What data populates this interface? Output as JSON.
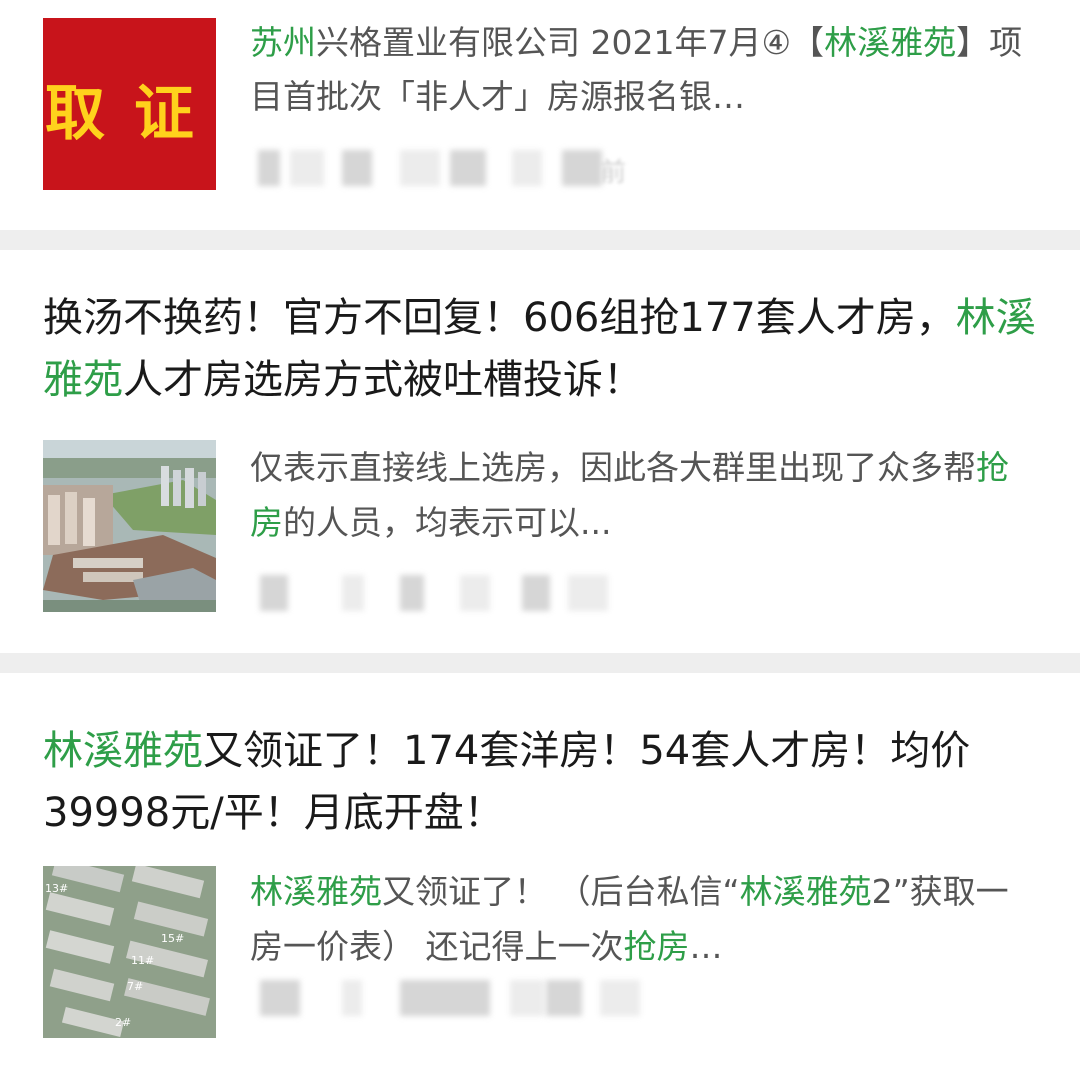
{
  "articles": [
    {
      "thumbnail_text": "取 证",
      "title_segments": [
        {
          "text": "苏州",
          "hl": true
        },
        {
          "text": "兴格置业有限公司 2021年7月④【",
          "hl": false
        },
        {
          "text": "林溪雅苑",
          "hl": true
        },
        {
          "text": "】项目首批次「非人才」房源报名银…",
          "hl": false
        }
      ],
      "meta_suffix": "前"
    },
    {
      "title_segments": [
        {
          "text": "换汤不换药！官方不回复！606组抢177套人才房，",
          "hl": false
        },
        {
          "text": "林溪雅苑",
          "hl": true
        },
        {
          "text": "人才房选房方式被吐槽投诉！",
          "hl": false
        }
      ],
      "snippet_segments": [
        {
          "text": "仅表示直接线上选房，因此各大群里出现了众多帮",
          "hl": false
        },
        {
          "text": "抢房",
          "hl": true
        },
        {
          "text": "的人员，均表示可以...",
          "hl": false
        }
      ]
    },
    {
      "title_segments": [
        {
          "text": "林溪雅苑",
          "hl": true
        },
        {
          "text": "又领证了！174套洋房！54套人才房！均价39998元/平！月底开盘！",
          "hl": false
        }
      ],
      "snippet_segments": [
        {
          "text": "林溪雅苑",
          "hl": true
        },
        {
          "text": "又领证了！ （后台私信“",
          "hl": false
        },
        {
          "text": "林溪雅苑",
          "hl": true
        },
        {
          "text": "2”获取一房一价表） 还记得上一次",
          "hl": false
        },
        {
          "text": "抢房",
          "hl": true
        },
        {
          "text": "…",
          "hl": false
        }
      ],
      "thumbnail_labels": [
        "13#",
        "15#",
        "11#",
        "7#",
        "2#"
      ]
    }
  ],
  "colors": {
    "highlight": "#2e9e48",
    "thumbnail_red": "#c8141b",
    "thumbnail_text": "#ffd21c",
    "separator": "#eeeeee"
  }
}
